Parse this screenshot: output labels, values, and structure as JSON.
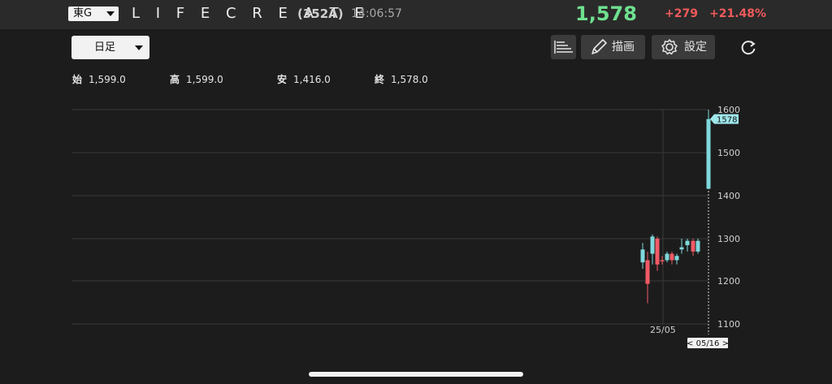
{
  "header": {
    "exchange": "東G",
    "name": "L I F E C R E A T E",
    "code": "(352A)",
    "time": "14:06:57",
    "price": "1,578",
    "change": "+279",
    "change_pct": "+21.48%"
  },
  "toolbar": {
    "period": "日足",
    "draw_label": "描画",
    "settings_label": "設定"
  },
  "ohlc": {
    "open_key": "始",
    "open": "1,599.0",
    "high_key": "高",
    "high": "1,599.0",
    "low_key": "安",
    "low": "1,416.0",
    "close_key": "終",
    "close": "1,578.0"
  },
  "colors": {
    "up": "#7fd8dd",
    "down": "#f05a66",
    "price_green": "#6fe08f"
  },
  "chart_data": {
    "type": "candlestick",
    "y_ticks": [
      "1600",
      "1500",
      "1400",
      "1300",
      "1200",
      "1100"
    ],
    "ylim": [
      1100,
      1600
    ],
    "x_tick": "25/05",
    "cursor_date": "< 05/16 >",
    "last_price_label": "1578",
    "candles": [
      {
        "o": 1245,
        "h": 1290,
        "l": 1230,
        "c": 1275
      },
      {
        "o": 1250,
        "h": 1270,
        "l": 1150,
        "c": 1195
      },
      {
        "o": 1265,
        "h": 1310,
        "l": 1240,
        "c": 1305
      },
      {
        "o": 1300,
        "h": 1305,
        "l": 1225,
        "c": 1240
      },
      {
        "o": 1250,
        "h": 1260,
        "l": 1240,
        "c": 1248
      },
      {
        "o": 1250,
        "h": 1270,
        "l": 1245,
        "c": 1265
      },
      {
        "o": 1265,
        "h": 1270,
        "l": 1240,
        "c": 1250
      },
      {
        "o": 1250,
        "h": 1265,
        "l": 1240,
        "c": 1260
      },
      {
        "o": 1275,
        "h": 1300,
        "l": 1265,
        "c": 1280
      },
      {
        "o": 1285,
        "h": 1300,
        "l": 1270,
        "c": 1295
      },
      {
        "o": 1295,
        "h": 1300,
        "l": 1260,
        "c": 1270
      },
      {
        "o": 1270,
        "h": 1300,
        "l": 1265,
        "c": 1295
      },
      {
        "o": 1416,
        "h": 1599,
        "l": 1416,
        "c": 1578
      }
    ]
  }
}
